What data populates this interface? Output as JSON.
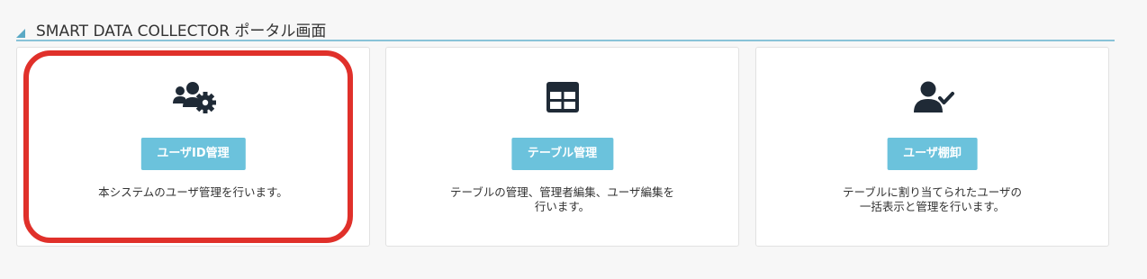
{
  "section": {
    "title": "SMART DATA COLLECTOR ポータル画面"
  },
  "cards": [
    {
      "icon": "users-gear-icon",
      "button_label": "ユーザID管理",
      "description": "本システムのユーザ管理を行います。"
    },
    {
      "icon": "table-icon",
      "button_label": "テーブル管理",
      "description": "テーブルの管理、管理者編集、ユーザ編集を\n行います。"
    },
    {
      "icon": "user-check-icon",
      "button_label": "ユーザ棚卸",
      "description": "テーブルに割り当てられたユーザの\n一括表示と管理を行います。"
    }
  ],
  "colors": {
    "button_bg": "#6bc2dc",
    "header_line": "#89c3d8",
    "icon": "#1f2a36",
    "highlight": "#e0302a"
  }
}
